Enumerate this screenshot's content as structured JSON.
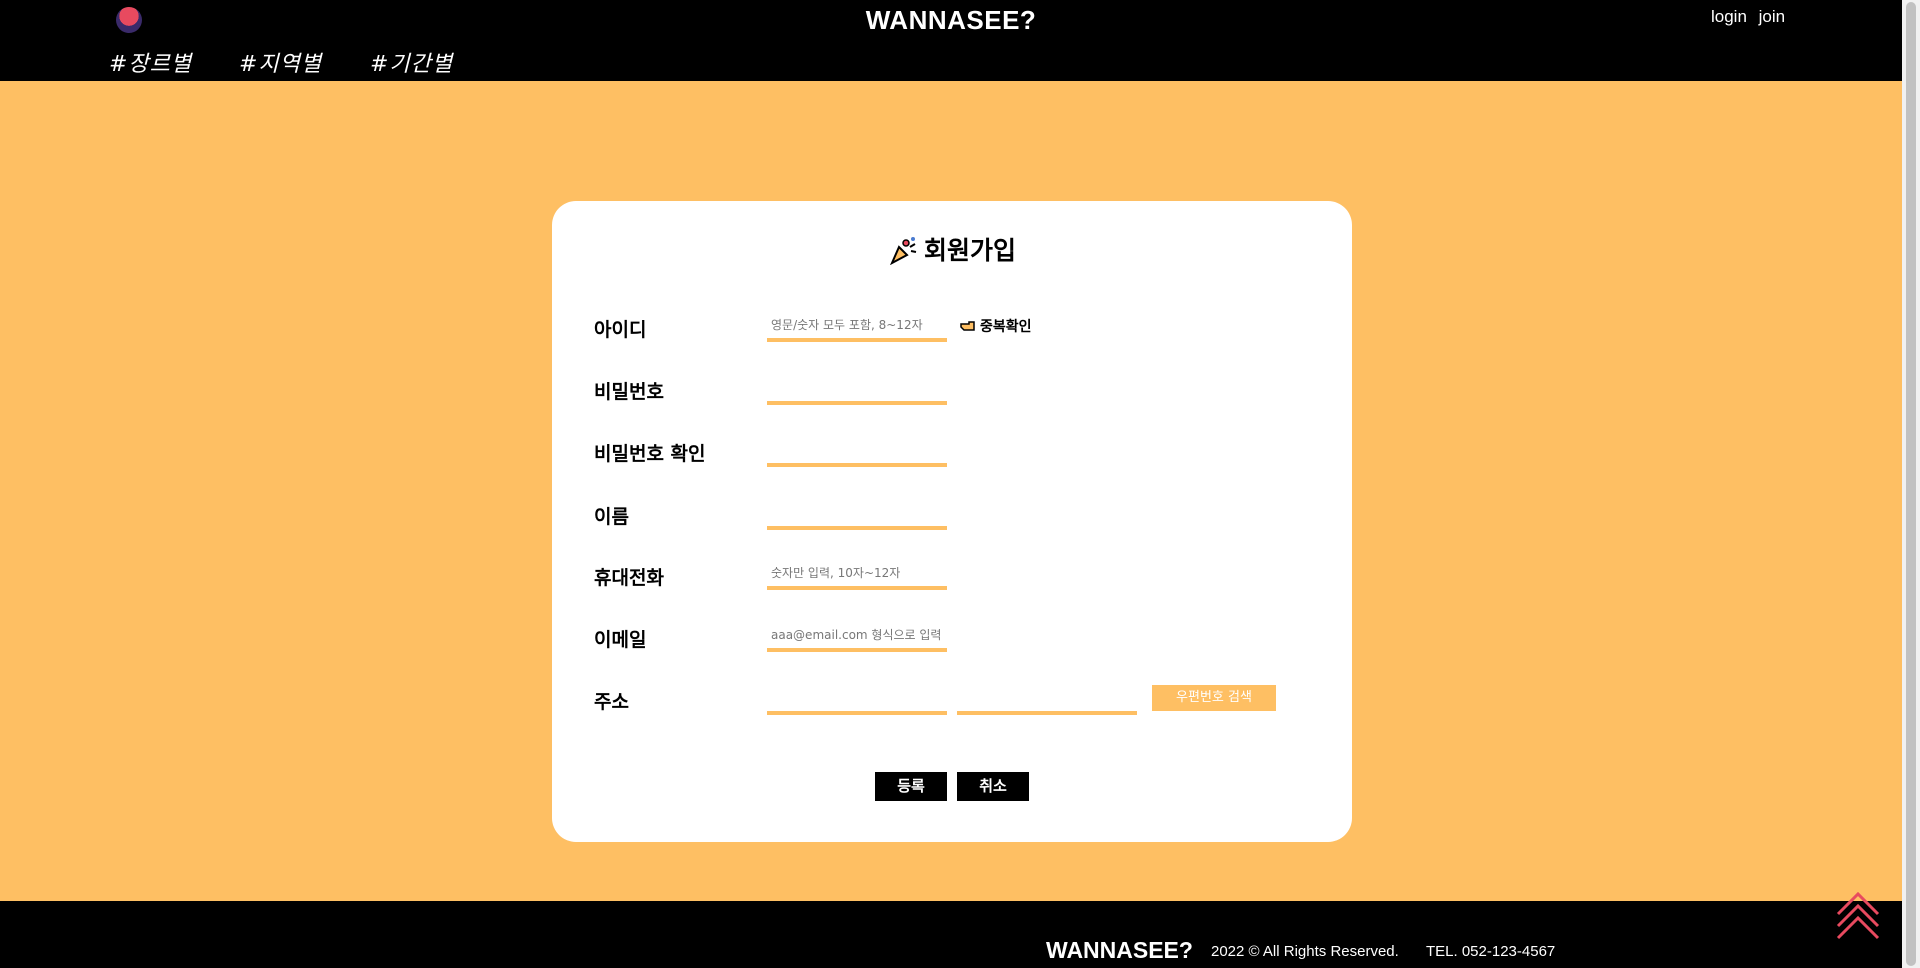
{
  "header": {
    "logo_icon": "sunset-logo-icon",
    "title": "WANNASEE?",
    "links": {
      "login": "login",
      "join": "join"
    },
    "nav": [
      "#장르별",
      "#지역별",
      "#기간별"
    ]
  },
  "form": {
    "title": "회원가입",
    "title_icon": "party-popper-icon",
    "fields": {
      "id": {
        "label": "아이디",
        "placeholder": "영문/숫자 모두 포함, 8~12자",
        "value": ""
      },
      "password": {
        "label": "비밀번호",
        "placeholder": "",
        "value": ""
      },
      "password_confirm": {
        "label": "비밀번호 확인",
        "placeholder": "",
        "value": ""
      },
      "name": {
        "label": "이름",
        "placeholder": "",
        "value": ""
      },
      "phone": {
        "label": "휴대전화",
        "placeholder": "숫자만 입력, 10자~12자",
        "value": ""
      },
      "email": {
        "label": "이메일",
        "placeholder": "aaa@email.com 형식으로 입력",
        "value": ""
      },
      "address": {
        "label": "주소",
        "value1": "",
        "value2": ""
      }
    },
    "duplicate_check": {
      "label": "중복확인",
      "icon": "pointing-hand-icon"
    },
    "zip_search_label": "우편번호 검색",
    "submit_label": "등록",
    "cancel_label": "취소"
  },
  "footer": {
    "brand": "WANNASEE?",
    "copyright": "2022 © All Rights Reserved.",
    "tel": "TEL. 052-123-4567",
    "scroll_top_icon": "double-chevron-up-icon"
  },
  "colors": {
    "background": "#FEBF63",
    "header": "#000000",
    "accent_red": "#E84A5F"
  }
}
